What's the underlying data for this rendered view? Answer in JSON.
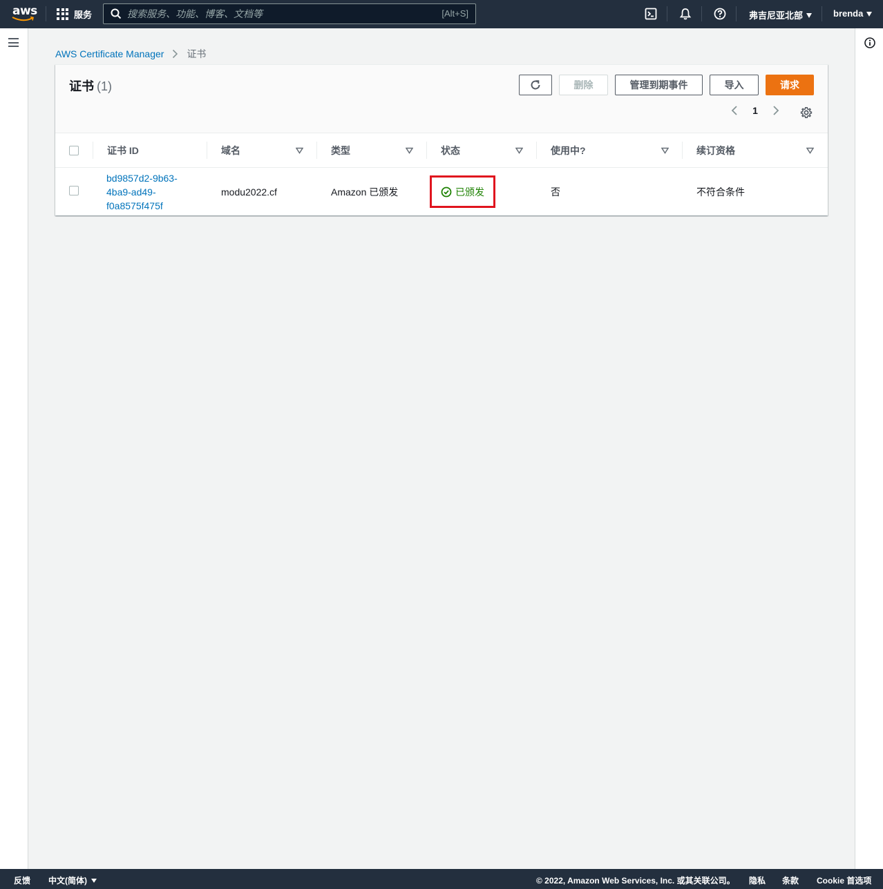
{
  "topnav": {
    "logo_text": "aws",
    "services_label": "服务",
    "search_placeholder": "搜索服务、功能、博客、文档等",
    "search_shortcut": "[Alt+S]",
    "region_label": "弗吉尼亚北部",
    "user_label": "brenda"
  },
  "breadcrumb": {
    "root": "AWS Certificate Manager",
    "current": "证书"
  },
  "panel": {
    "title": "证书",
    "count": "(1)",
    "buttons": {
      "delete": "删除",
      "manage_expiry": "管理到期事件",
      "import": "导入",
      "request": "请求"
    },
    "page_number": "1"
  },
  "table": {
    "columns": [
      "证书 ID",
      "域名",
      "类型",
      "状态",
      "使用中?",
      "续订资格"
    ],
    "rows": [
      {
        "cert_id_lines": [
          "bd9857d2-9b63-",
          "4ba9-ad49-",
          "f0a8575f475f"
        ],
        "domain": "modu2022.cf",
        "type": "Amazon 已颁发",
        "status": "已颁发",
        "in_use": "否",
        "renewal": "不符合条件"
      }
    ]
  },
  "footer": {
    "feedback": "反馈",
    "language": "中文(简体)",
    "copyright": "© 2022, Amazon Web Services, Inc. 或其关联公司。",
    "privacy": "隐私",
    "terms": "条款",
    "cookies": "Cookie 首选项"
  },
  "colors": {
    "nav_bg": "#232f3e",
    "primary": "#ec7211",
    "link": "#0073bb",
    "success": "#1d8102",
    "highlight": "#e0141e"
  },
  "icons": [
    "hamburger-icon",
    "services-grid-icon",
    "search-icon",
    "cloudshell-icon",
    "bell-icon",
    "help-icon",
    "info-icon",
    "refresh-icon",
    "chevron-left-icon",
    "chevron-right-icon",
    "settings-gear-icon",
    "sort-icon",
    "success-check-icon"
  ]
}
